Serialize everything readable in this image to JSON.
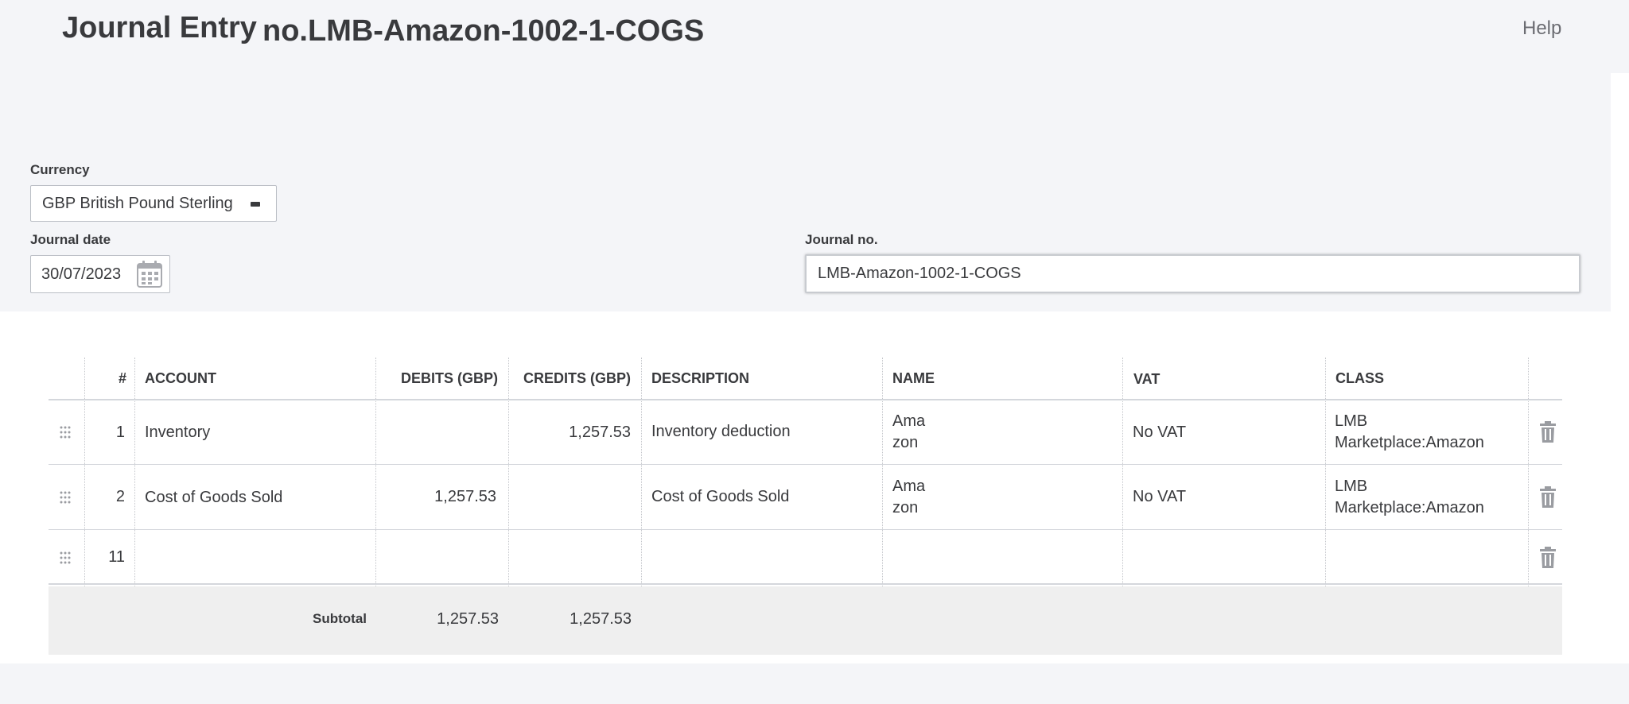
{
  "header": {
    "title": "Journal Entry",
    "journal_number": "no.LMB-Amazon-1002-1-COGS",
    "help_label": "Help"
  },
  "form": {
    "currency_label": "Currency",
    "currency_value": "GBP British Pound Sterling",
    "journal_date_label": "Journal date",
    "journal_date_value": "30/07/2023",
    "journal_no_label": "Journal no.",
    "journal_no_value": "LMB-Amazon-1002-1-COGS"
  },
  "table": {
    "columns": {
      "num": "#",
      "account": "ACCOUNT",
      "debits": "DEBITS (GBP)",
      "credits": "CREDITS (GBP)",
      "description": "DESCRIPTION",
      "name": "NAME",
      "vat": "VAT",
      "class": "CLASS"
    },
    "rows": [
      {
        "num": "1",
        "account": "Inventory",
        "debits": "",
        "credits": "1,257.53",
        "description": "Inventory deduction",
        "name_line1": "Ama",
        "name_line2": "zon",
        "vat": "No VAT",
        "class_line1": "LMB",
        "class_line2": "Marketplace:Amazon"
      },
      {
        "num": "2",
        "account": "Cost of Goods Sold",
        "debits": "1,257.53",
        "credits": "",
        "description": "Cost of Goods Sold",
        "name_line1": "Ama",
        "name_line2": "zon",
        "vat": "No VAT",
        "class_line1": "LMB",
        "class_line2": "Marketplace:Amazon"
      },
      {
        "num": "11",
        "account": "",
        "debits": "",
        "credits": "",
        "description": "",
        "name_line1": "",
        "name_line2": "",
        "vat": "",
        "class_line1": "",
        "class_line2": ""
      }
    ],
    "subtotal": {
      "label": "Subtotal",
      "debits": "1,257.53",
      "credits": "1,257.53"
    }
  },
  "icons": {
    "currency_dropdown": "dropdown-icon",
    "calendar": "calendar-icon",
    "drag": "drag-handle-icon",
    "delete": "trash-icon"
  },
  "colors": {
    "page_background": "#f4f5f8",
    "table_background": "#ffffff",
    "text": "#393a3d",
    "muted": "#6b6c72",
    "subtotal_background": "#efefef"
  }
}
